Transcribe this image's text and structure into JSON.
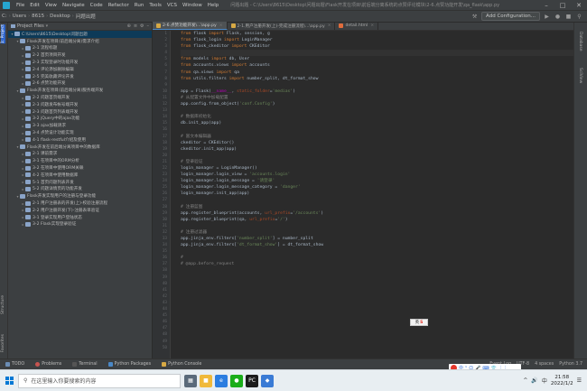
{
  "titlebar": {
    "menu": [
      "File",
      "Edit",
      "View",
      "Navigate",
      "Code",
      "Refactor",
      "Run",
      "Tools",
      "VCS",
      "Window",
      "Help"
    ],
    "window_title": "问题出题 - C:\\Users\\8615\\Desktop\\问题出题\\Flask开发在项目\\前后端分离系统的点赞评论模块\\2-6.点赞功能开发\\qa_flask\\app.py"
  },
  "navbar": {
    "breadcrumbs": [
      "C:",
      "Users",
      "8615",
      "Desktop",
      "问题出题"
    ],
    "add_config": "Add Configuration..."
  },
  "left_strip": {
    "project": "1: Project",
    "structure": "Structure",
    "favorites": "Favorites"
  },
  "project_panel": {
    "header": "Project Files",
    "items": [
      {
        "label": "C:\\Users\\8615\\Desktop\\问题出题",
        "indent": 0,
        "arrow": "▾",
        "selected": true
      },
      {
        "label": "Flask开发在项目(前后端分离)需求介绍",
        "indent": 1,
        "arrow": "▾",
        "selected": false
      },
      {
        "label": "2-1 流程标题",
        "indent": 2,
        "arrow": "▸",
        "selected": false
      },
      {
        "label": "2-2 首页项目开发",
        "indent": 2,
        "arrow": "▸",
        "selected": false
      },
      {
        "label": "2-3 实现登录时功能开发",
        "indent": 2,
        "arrow": "▸",
        "selected": false
      },
      {
        "label": "2-4 评论添加删除编辑",
        "indent": 2,
        "arrow": "▸",
        "selected": false
      },
      {
        "label": "2-5 完美收藏评论开发",
        "indent": 2,
        "arrow": "▸",
        "selected": false
      },
      {
        "label": "2-6 点赞功能开发",
        "indent": 2,
        "arrow": "▸",
        "selected": false
      },
      {
        "label": "Flask开发在项目(前后端分离)服务端开发",
        "indent": 1,
        "arrow": "▾",
        "selected": false
      },
      {
        "label": "2-2 问题首页端开发",
        "indent": 2,
        "arrow": "▸",
        "selected": false
      },
      {
        "label": "2-3 问题发布帐号端开发",
        "indent": 2,
        "arrow": "▸",
        "selected": false
      },
      {
        "label": "2-3 问题首页列表端开发",
        "indent": 2,
        "arrow": "▸",
        "selected": false
      },
      {
        "label": "3-2 jQuery中的ajax功能",
        "indent": 2,
        "arrow": "▸",
        "selected": false
      },
      {
        "label": "3-3 ajax加载请求",
        "indent": 2,
        "arrow": "▸",
        "selected": false
      },
      {
        "label": "3-4 点赞设计功能实现",
        "indent": 2,
        "arrow": "▸",
        "selected": false
      },
      {
        "label": "4-1 flask-restful介绍及使用",
        "indent": 2,
        "arrow": "▸",
        "selected": false
      },
      {
        "label": "Flask开发在前后端分离项目中的数据库",
        "indent": 1,
        "arrow": "▾",
        "selected": false
      },
      {
        "label": "2-1 课前需求",
        "indent": 2,
        "arrow": "▸",
        "selected": false
      },
      {
        "label": "3-1 在项目中的ORM分析",
        "indent": 2,
        "arrow": "▸",
        "selected": false
      },
      {
        "label": "3-2 在项目中使用ORM关联",
        "indent": 2,
        "arrow": "▸",
        "selected": false
      },
      {
        "label": "4-2 在项目中使用数据库",
        "indent": 2,
        "arrow": "▸",
        "selected": false
      },
      {
        "label": "5-1 首页问题列表开发",
        "indent": 2,
        "arrow": "▸",
        "selected": false
      },
      {
        "label": "5-2 问题详情页的功能开发",
        "indent": 2,
        "arrow": "▸",
        "selected": false
      },
      {
        "label": "Flask开发实现用户的注册与登录功能",
        "indent": 1,
        "arrow": "▾",
        "selected": false
      },
      {
        "label": "2-1 用户注册表的开发(上)-校验注册流程",
        "indent": 2,
        "arrow": "▸",
        "selected": false
      },
      {
        "label": "2-2 用户注册开发(下)-注册表单验证",
        "indent": 2,
        "arrow": "▸",
        "selected": false
      },
      {
        "label": "3-1 登录实现用户登陆状态",
        "indent": 2,
        "arrow": "▸",
        "selected": false
      },
      {
        "label": "3-2 Flask实现登录验证",
        "indent": 2,
        "arrow": "▸",
        "selected": false
      }
    ]
  },
  "tabs": [
    {
      "label": "2-6.点赞功能开发\\...\\app.py",
      "type": "py",
      "active": true
    },
    {
      "label": "2-1.用户注册开发(上)-完成注册流程\\...\\app.py",
      "type": "py",
      "active": false
    },
    {
      "label": "detail.html",
      "type": "html",
      "active": false
    }
  ],
  "code": [
    "from flask import Flask, session, g",
    "from flask_login import LoginManager",
    "from flask_ckeditor import CKEditor",
    "",
    "from models import db, User",
    "from accounts.views import accounts",
    "from qa.views import qa",
    "from utils.filters import number_split, dt_format_show",
    "",
    "app = Flask(__name__, static_folder='medias')",
    "# 从配置文件中加载配置",
    "app.config.from_object('conf.Config')",
    "",
    "# 数据库初始化",
    "db.init_app(app)",
    "",
    "# 富文本编辑器",
    "ckeditor = CKEditor()",
    "ckeditor.init_app(app)",
    "",
    "# 登录验证",
    "login_manager = LoginManager()",
    "login_manager.login_view = 'accounts.login'",
    "login_manager.login_message = '请登录'",
    "login_manager.login_message_category = 'danger'",
    "login_manager.init_app(app)",
    "",
    "# 注册蓝图",
    "app.register_blueprint(accounts, url_prefix='/accounts')",
    "app.register_blueprint(qa, url_prefix='/')",
    "",
    "# 注册过滤器",
    "app.jinja_env.filters['number_split'] = number_split",
    "app.jinja_env.filters['dt_format_show'] = dt_format_show",
    "",
    "#",
    "# @app.before_request"
  ],
  "gutter_numbers": [
    "1",
    "2",
    "3",
    "4",
    "5",
    "6",
    "7",
    "8",
    "9",
    "10",
    "11",
    "12",
    "13",
    "14",
    "15",
    "16",
    "17",
    "18",
    "19",
    "20",
    "21",
    "22",
    "23",
    "24",
    "25",
    "26",
    "27",
    "28",
    "29",
    "30",
    "31",
    "32",
    "33",
    "34",
    "35",
    "36",
    "37",
    "38",
    "39",
    "40",
    "41",
    "42",
    "43",
    "44",
    "45",
    "46",
    "47",
    "48",
    "49",
    "50"
  ],
  "ime_popup": {
    "text": "英"
  },
  "right_strip": {
    "sciview": "SciView",
    "database": "Database"
  },
  "bottom_toolbar": {
    "items": [
      "TODO",
      "Problems",
      "Terminal",
      "Python Packages",
      "Python Console"
    ],
    "event_log": "Event Log",
    "status": [
      "UTF-8",
      "4 spaces",
      "Python 3.7"
    ]
  },
  "sogou": {
    "chars": [
      "中",
      "¹",
      "☺",
      "🎤",
      "⌨",
      "👕",
      "⋮⋮"
    ]
  },
  "taskbar": {
    "search_placeholder": "在这里输入你要搜索的内容",
    "time": "21:58",
    "date": "2022/1/2",
    "tray": [
      "^",
      "🔊",
      "中"
    ]
  },
  "colors": {
    "editor_bg": "#2b2b2b",
    "panel_bg": "#3c3f41",
    "keyword": "#cc7832",
    "string": "#6a8759",
    "comment": "#808080",
    "selection": "#0d3a58",
    "accent_blue": "#2f65ca"
  }
}
